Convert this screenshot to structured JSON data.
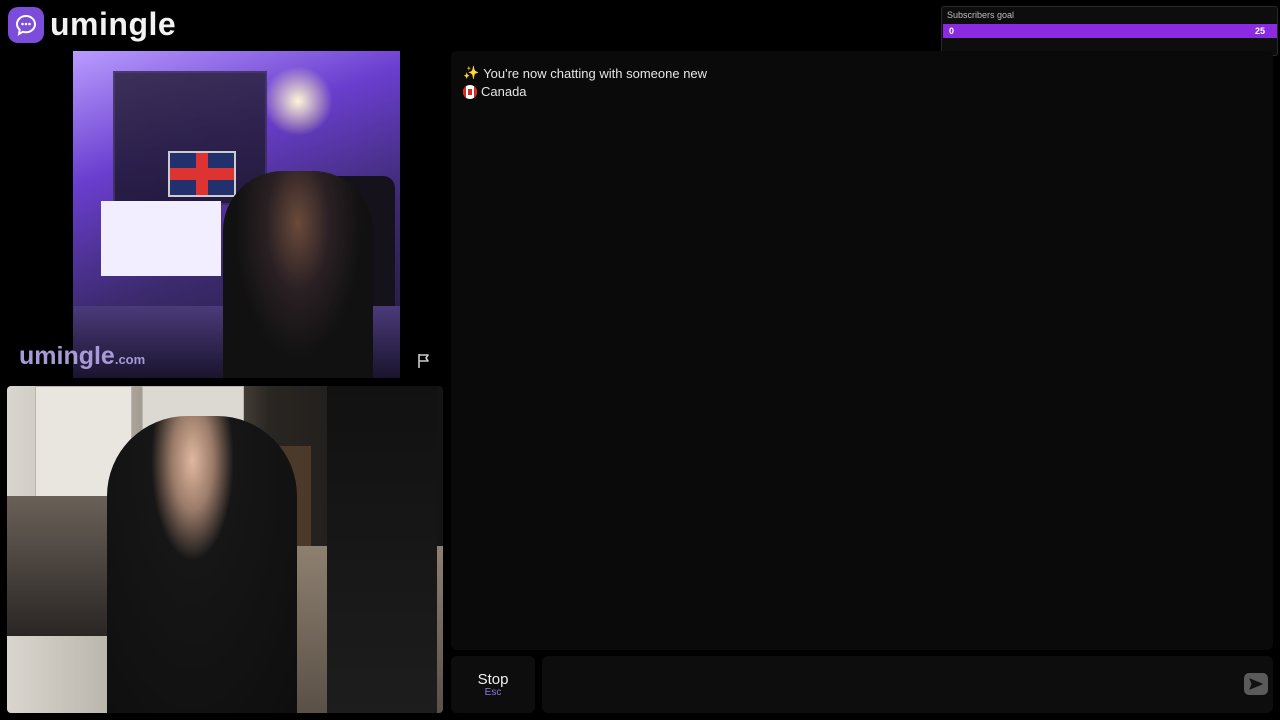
{
  "app": {
    "name": "umingle"
  },
  "goal_widget": {
    "title": "Subscribers goal",
    "current": "0",
    "target": "25",
    "progress": 0.0
  },
  "remote_video": {
    "watermark_name": "umingle",
    "watermark_domain": ".com",
    "report_icon": "flag-icon"
  },
  "local_video": {},
  "chat": {
    "messages": [
      {
        "icon": "sparkles",
        "text": "You're now chatting with someone new"
      },
      {
        "icon": "canada-flag",
        "text": "Canada"
      }
    ]
  },
  "controls": {
    "stop_label": "Stop",
    "stop_shortcut": "Esc",
    "message_placeholder": "",
    "send_icon": "send-icon"
  },
  "colors": {
    "brand": "#7c4ddb",
    "goal_bar": "#8a2be2",
    "panel": "#0a0a0a"
  }
}
